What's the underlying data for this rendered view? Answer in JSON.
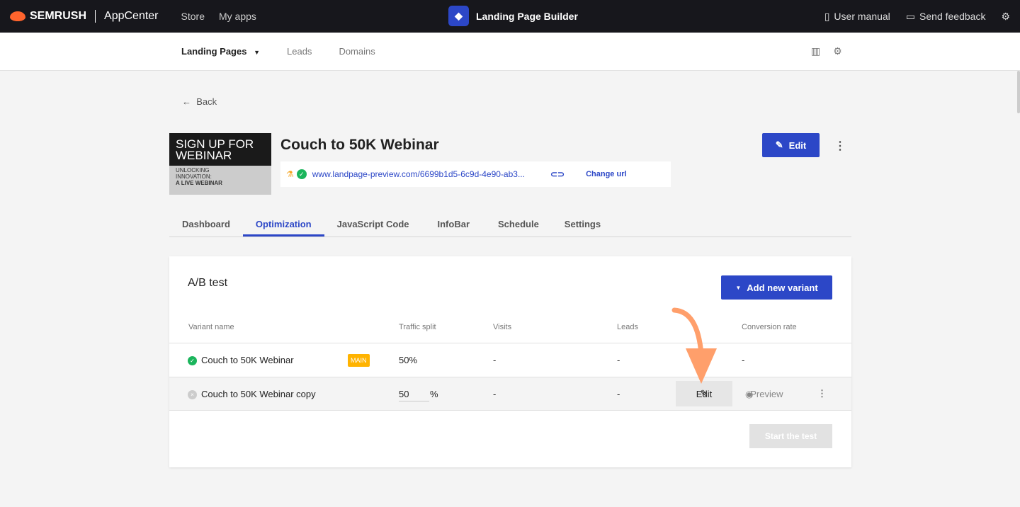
{
  "topbar": {
    "brand": "SEMRUSH",
    "product": "AppCenter",
    "nav": [
      "Store",
      "My apps"
    ],
    "app_title": "Landing Page Builder",
    "user_manual": "User manual",
    "send_feedback": "Send feedback"
  },
  "subnav": {
    "items": [
      "Landing Pages",
      "Leads",
      "Domains"
    ]
  },
  "back": "Back",
  "page": {
    "thumbnail": {
      "line1": "SIGN UP FOR",
      "line2": "WEBINAR",
      "line3": "UNLOCKING",
      "line4": "INNOVATION:",
      "line5": "A LIVE WEBINAR"
    },
    "title": "Couch to 50K Webinar",
    "url": "www.landpage-preview.com/6699b1d5-6c9d-4e90-ab3...",
    "change_url": "Change url",
    "edit": "Edit"
  },
  "tabs": [
    "Dashboard",
    "Optimization",
    "JavaScript Code",
    "InfoBar",
    "Schedule",
    "Settings"
  ],
  "ab": {
    "title": "A/B test",
    "add_variant": "Add new variant",
    "columns": [
      "Variant name",
      "Traffic split",
      "Visits",
      "Leads",
      "Conversion rate"
    ],
    "rows": [
      {
        "name": "Couch to 50K Webinar",
        "badge": "MAIN",
        "split": "50%",
        "visits": "-",
        "leads": "-",
        "conversion": "-"
      },
      {
        "name": "Couch to 50K Webinar copy",
        "split": "50",
        "unit": "%",
        "visits": "-",
        "leads": "-",
        "edit": "Edit",
        "preview": "Preview"
      }
    ],
    "start": "Start the test"
  },
  "colors": {
    "accent": "#2c47c7",
    "annotation": "#ff9f6b"
  }
}
